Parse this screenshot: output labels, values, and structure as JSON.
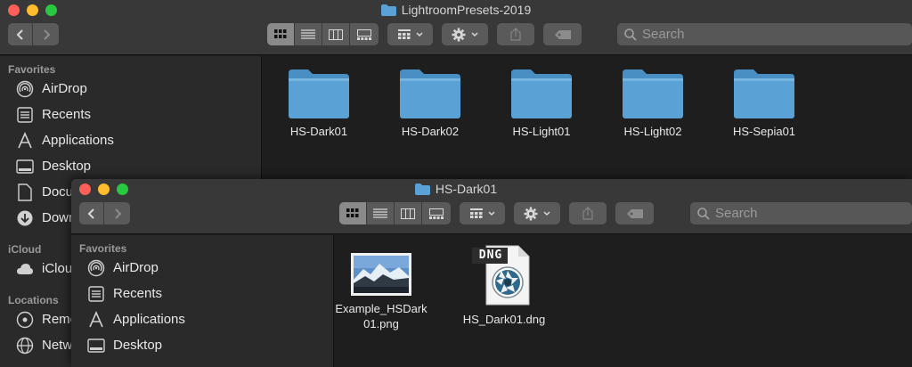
{
  "window1": {
    "title": "LightroomPresets-2019",
    "search": {
      "placeholder": "Search"
    },
    "sidebar": {
      "sections": [
        {
          "heading": "Favorites",
          "items": [
            "AirDrop",
            "Recents",
            "Applications",
            "Desktop",
            "Docu",
            "Down"
          ]
        },
        {
          "heading": "iCloud",
          "items": [
            "iClou"
          ]
        },
        {
          "heading": "Locations",
          "items": [
            "Remo",
            "Netw"
          ]
        }
      ]
    },
    "folders": [
      "HS-Dark01",
      "HS-Dark02",
      "HS-Light01",
      "HS-Light02",
      "HS-Sepia01"
    ]
  },
  "window2": {
    "title": "HS-Dark01",
    "search": {
      "placeholder": "Search"
    },
    "sidebar": {
      "heading": "Favorites",
      "items": [
        "AirDrop",
        "Recents",
        "Applications",
        "Desktop"
      ]
    },
    "files": [
      {
        "name_line1": "Example_HSDark",
        "name_line2": "01.png",
        "icon": "image-thumbnail-icon"
      },
      {
        "name_line1": "HS_Dark01.dng",
        "name_line2": "",
        "icon": "dng-file-icon",
        "badge": "DNG"
      }
    ]
  },
  "colors": {
    "folder_blue": "#5aa2d6",
    "folder_tab": "#4a8fc4",
    "selected_view": "#8a8a8a"
  },
  "icons": {
    "back": "chevron-left-icon",
    "forward": "chevron-right-icon",
    "view_icons": "icon-view-icon",
    "view_list": "list-view-icon",
    "view_columns": "column-view-icon",
    "view_gallery": "gallery-view-icon",
    "group": "group-icon",
    "action": "gear-icon",
    "share": "share-icon",
    "tags": "tag-icon",
    "search": "search-icon"
  }
}
